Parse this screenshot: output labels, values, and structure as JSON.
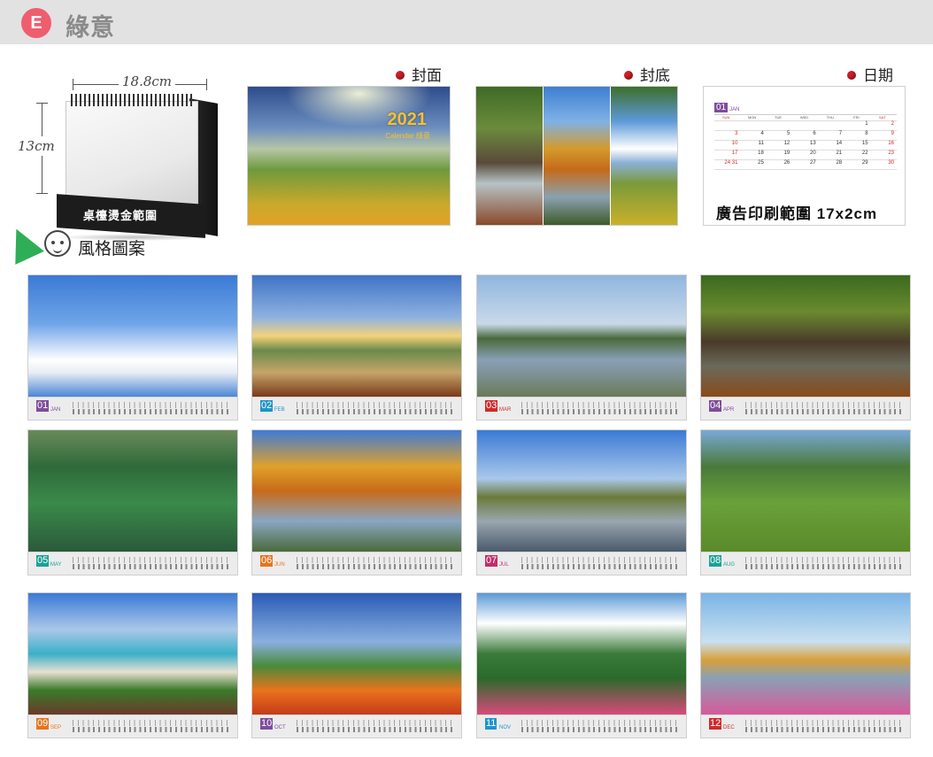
{
  "header": {
    "badge": "E",
    "title": "綠意"
  },
  "desk": {
    "width_label": "18.8cm",
    "height_label": "13cm",
    "base_text": "桌檯燙金範圍"
  },
  "style": {
    "label": "風格圖案"
  },
  "previews": {
    "cover_label": "封面",
    "back_label": "封底",
    "date_label": "日期",
    "cover_year": "2021",
    "cover_sub": "Calendar  綠意",
    "date_month_num": "01",
    "date_month_name": "JAN",
    "date_ad_text": "廣告印刷範圍 17x2cm",
    "weekday_headers": [
      "SUN",
      "MON",
      "TUE",
      "WED",
      "THU",
      "FRI",
      "SAT"
    ],
    "date_rows": [
      [
        "",
        "",
        "",
        "",
        "",
        "1",
        "2"
      ],
      [
        "3",
        "4",
        "5",
        "6",
        "7",
        "8",
        "9"
      ],
      [
        "10",
        "11",
        "12",
        "13",
        "14",
        "15",
        "16"
      ],
      [
        "17",
        "18",
        "19",
        "20",
        "21",
        "22",
        "23"
      ],
      [
        "24 31",
        "25",
        "26",
        "27",
        "28",
        "29",
        "30"
      ]
    ]
  },
  "months": [
    {
      "num": "01",
      "name": "JAN",
      "color": "#7e4d9a"
    },
    {
      "num": "02",
      "name": "FEB",
      "color": "#1d95c9"
    },
    {
      "num": "03",
      "name": "MAR",
      "color": "#d1292a"
    },
    {
      "num": "04",
      "name": "APR",
      "color": "#7e4d9a"
    },
    {
      "num": "05",
      "name": "MAY",
      "color": "#1aa198"
    },
    {
      "num": "06",
      "name": "JUN",
      "color": "#e8741c"
    },
    {
      "num": "07",
      "name": "JUL",
      "color": "#c42c6b"
    },
    {
      "num": "08",
      "name": "AUG",
      "color": "#1aa198"
    },
    {
      "num": "09",
      "name": "SEP",
      "color": "#e8741c"
    },
    {
      "num": "10",
      "name": "OCT",
      "color": "#7e4d9a"
    },
    {
      "num": "11",
      "name": "NOV",
      "color": "#1d95c9"
    },
    {
      "num": "12",
      "name": "DEC",
      "color": "#d1292a"
    }
  ]
}
